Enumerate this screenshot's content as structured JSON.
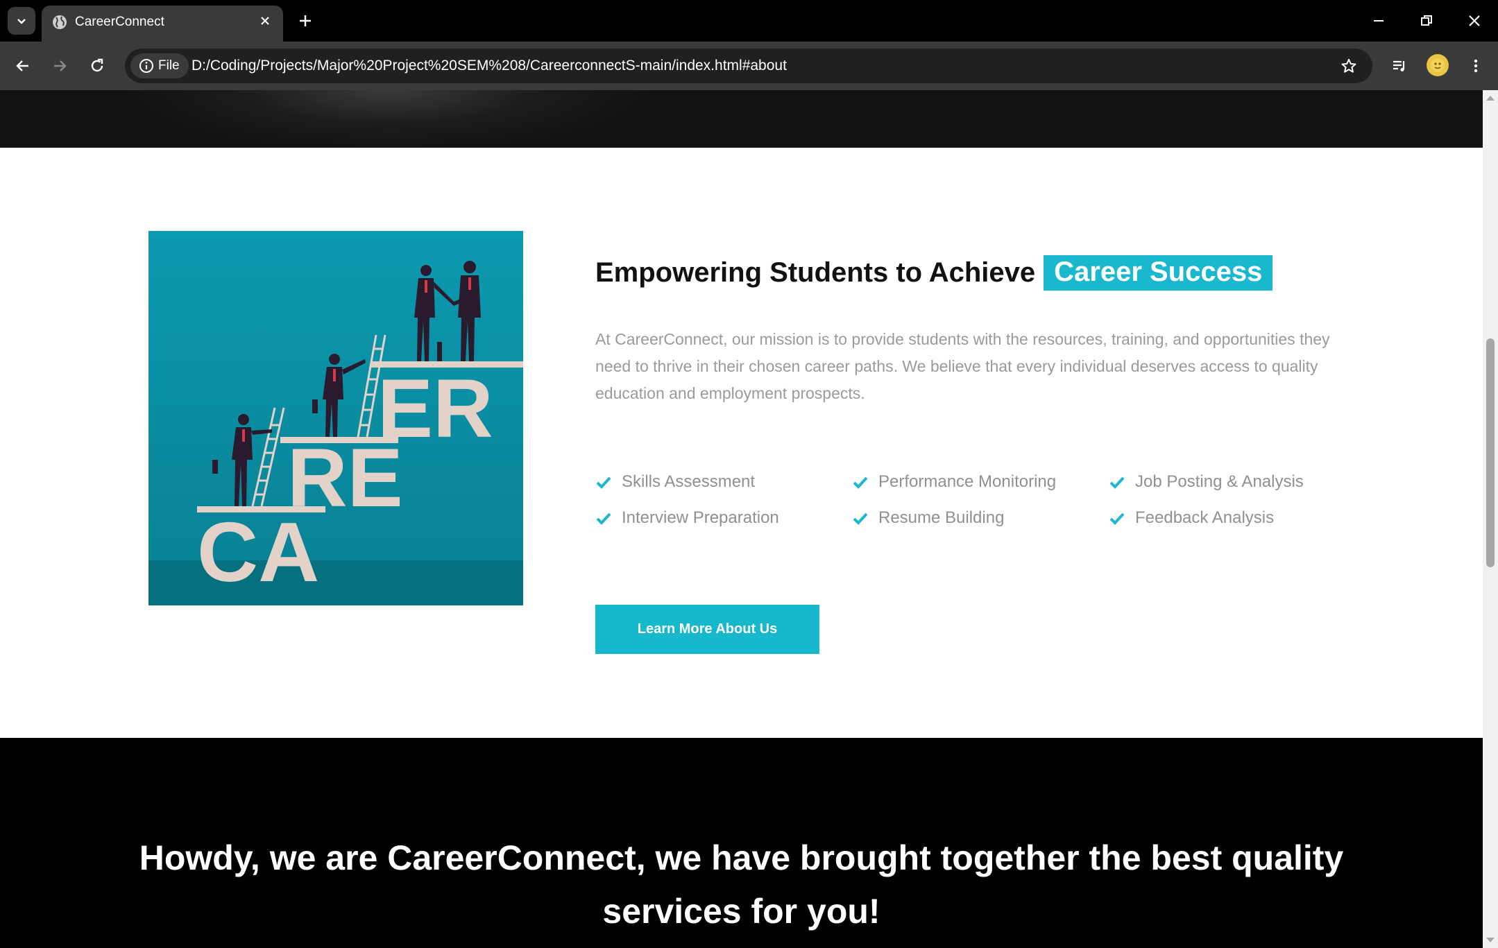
{
  "browser": {
    "tab_title": "CareerConnect",
    "site_chip_label": "File",
    "url": "D:/Coding/Projects/Major%20Project%20SEM%208/CareerconnectS-main/index.html#about"
  },
  "about": {
    "image_letters": {
      "row1": "ER",
      "row2": "RE",
      "row3": "CA"
    },
    "title_prefix": "Empowering Students to Achieve",
    "title_highlight": "Career Success",
    "description": "At CareerConnect, our mission is to provide students with the resources, training, and opportunities they need to thrive in their chosen career paths. We believe that every individual deserves access to quality education and employment prospects.",
    "features": [
      "Skills Assessment",
      "Performance Monitoring",
      "Job Posting & Analysis",
      "Interview Preparation",
      "Resume Building",
      "Feedback Analysis"
    ],
    "button_label": "Learn More About Us"
  },
  "services": {
    "heading_line1": "Howdy, we are CareerConnect, we have brought together the best quality",
    "heading_line2": "services for you!"
  },
  "colors": {
    "accent": "#1ab8cf",
    "image_background": "#0b97ad",
    "letters": "#e2d2c8",
    "chrome_dark": "#000000",
    "chrome_toolbar": "#3a3a3a"
  }
}
